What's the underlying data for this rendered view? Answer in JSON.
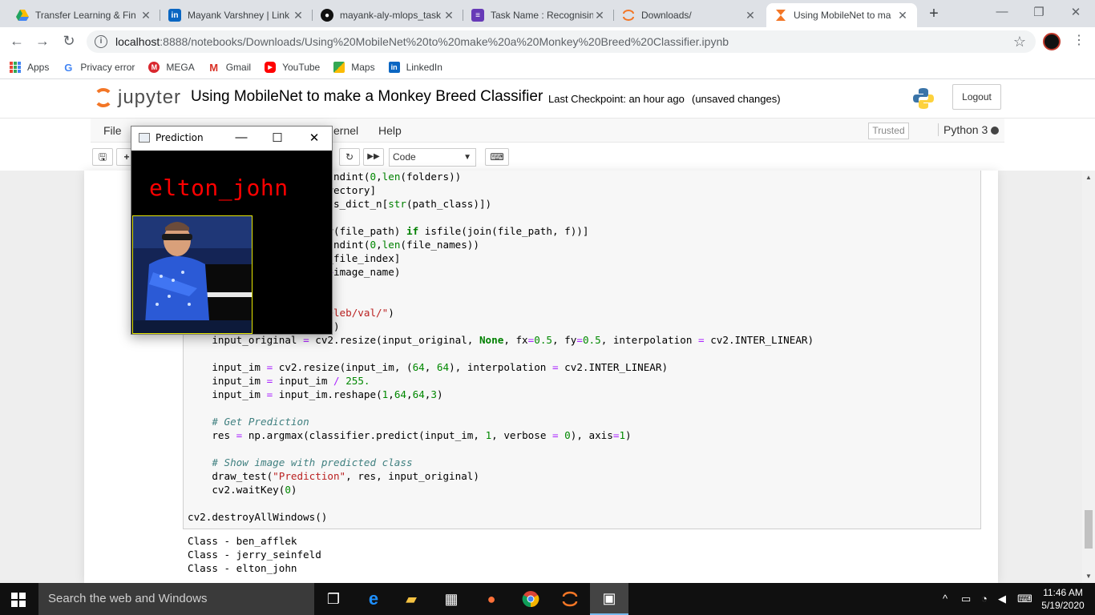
{
  "browser": {
    "tabs": [
      {
        "title": "Transfer Learning & Fin",
        "icon": "google-drive-icon",
        "color": "#1fa463"
      },
      {
        "title": "Mayank Varshney | Link",
        "icon": "linkedin-icon",
        "color": "#0a66c2"
      },
      {
        "title": "mayank-aly-mlops_task",
        "icon": "github-icon",
        "color": "#111111"
      },
      {
        "title": "Task Name : Recognisin",
        "icon": "forms-icon",
        "color": "#673ab7"
      },
      {
        "title": "Downloads/",
        "icon": "jupyter-icon",
        "color": "#f37626"
      },
      {
        "title": "Using MobileNet to ma",
        "icon": "hourglass-icon",
        "color": "#f37626",
        "active": true
      }
    ],
    "url_host": "localhost",
    "url_path": ":8888/notebooks/Downloads/Using%20MobileNet%20to%20make%20a%20Monkey%20Breed%20Classifier.ipynb",
    "bookmarks": [
      {
        "label": "Apps"
      },
      {
        "label": "Privacy error"
      },
      {
        "label": "MEGA"
      },
      {
        "label": "Gmail"
      },
      {
        "label": "YouTube"
      },
      {
        "label": "Maps"
      },
      {
        "label": "LinkedIn"
      }
    ]
  },
  "jupyter": {
    "logo_text": "jupyter",
    "notebook_title": "Using MobileNet to make a Monkey Breed Classifier",
    "checkpoint": "Last Checkpoint: an hour ago",
    "unsaved": "(unsaved changes)",
    "logout": "Logout",
    "menu": {
      "file": "File",
      "kernel": "ernel",
      "help": "Help"
    },
    "trusted": "Trusted",
    "kernel_name": "Python 3",
    "cell_type": "Code"
  },
  "prediction_window": {
    "title": "Prediction",
    "label": "elton_john"
  },
  "output": {
    "lines": [
      "Class - ben_afflek",
      "Class - jerry_seinfeld",
      "Class - elton_john"
    ]
  },
  "taskbar": {
    "search_placeholder": "Search the web and Windows",
    "time": "11:46 AM",
    "date": "5/19/2020"
  }
}
